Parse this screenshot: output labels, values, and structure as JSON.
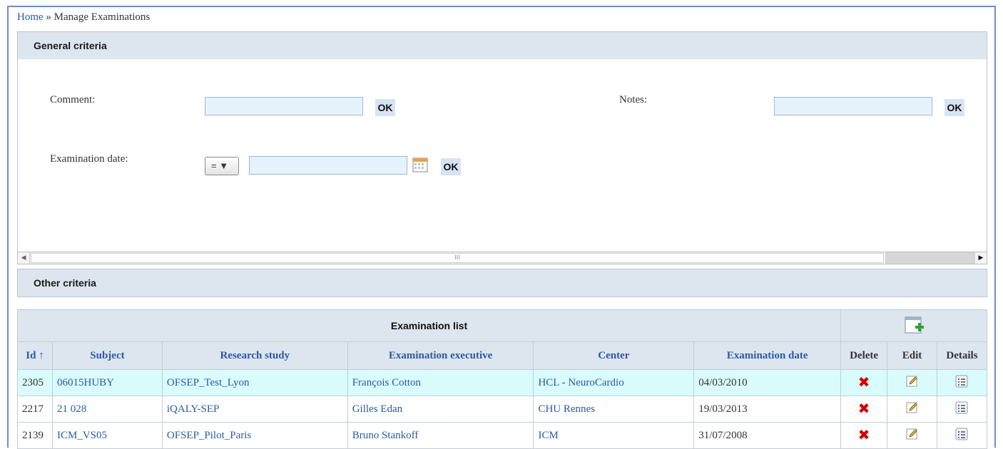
{
  "breadcrumb": {
    "home": "Home",
    "separator": " » ",
    "current": "Manage Examinations"
  },
  "general_criteria": {
    "title": "General criteria",
    "comment_label": "Comment:",
    "comment_value": "",
    "comment_ok": "OK",
    "notes_label": "Notes:",
    "notes_value": "",
    "notes_ok": "OK",
    "date_label": "Examination date:",
    "date_operator": "= ▼",
    "date_value": "",
    "date_ok": "OK",
    "scroll_grip": "III"
  },
  "other_criteria": {
    "title": "Other criteria"
  },
  "examination_list": {
    "caption": "Examination list",
    "columns": [
      "Id ↑",
      "Subject",
      "Research study",
      "Examination executive",
      "Center",
      "Examination date",
      "Delete",
      "Edit",
      "Details"
    ],
    "rows": [
      {
        "id": "2305",
        "subject": "06015HUBY",
        "study": "OFSEP_Test_Lyon",
        "executive": "François Cotton",
        "center": "HCL - NeuroCardio",
        "date": "04/03/2010"
      },
      {
        "id": "2217",
        "subject": "21 028",
        "study": "iQALY-SEP",
        "executive": "Gilles Edan",
        "center": "CHU Rennes",
        "date": "19/03/2013"
      },
      {
        "id": "2139",
        "subject": "ICM_VS05",
        "study": "OFSEP_Pilot_Paris",
        "executive": "Bruno Stankoff",
        "center": "ICM",
        "date": "31/07/2008"
      }
    ],
    "delete_glyph": "✖"
  },
  "colors": {
    "link": "#2a5aa8",
    "header_bg": "#dde5ee",
    "highlight_row": "#d9fbfb",
    "delete": "#d40000",
    "frame": "#6a8fc7"
  }
}
